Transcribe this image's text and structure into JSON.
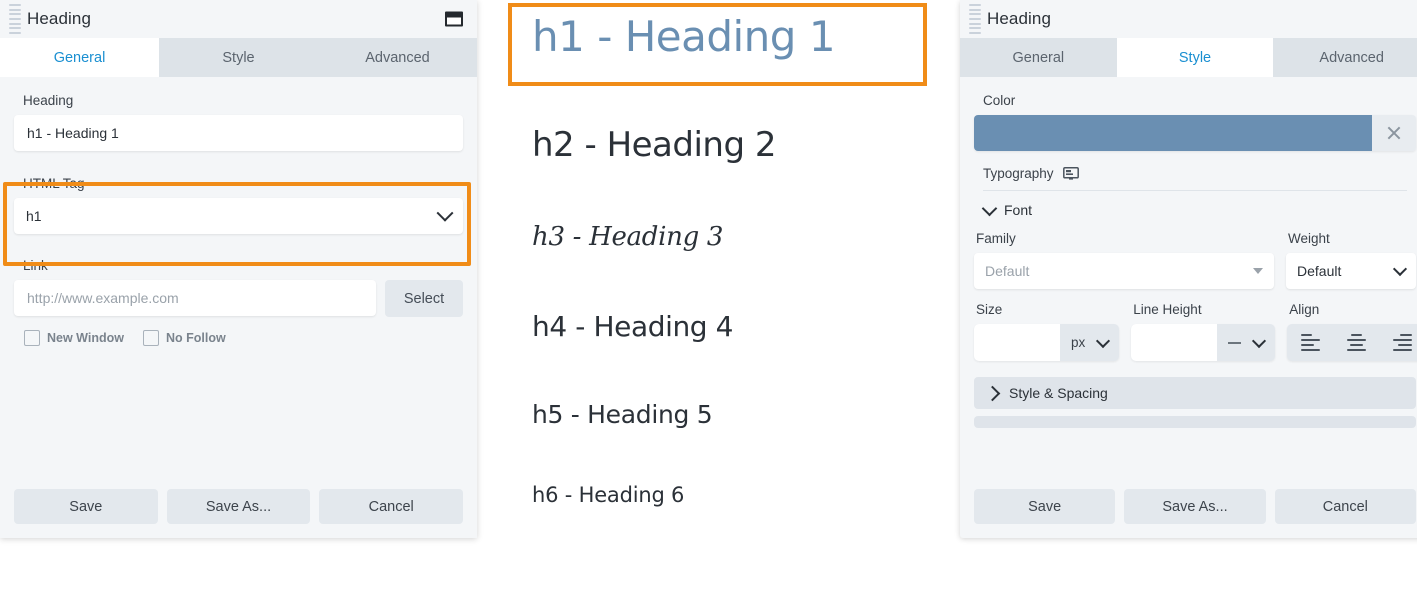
{
  "left_panel": {
    "title": "Heading",
    "window_button_icon": "restore-window-icon",
    "drag_handle_icon": "drag-handle-icon",
    "tabs": [
      {
        "label": "General",
        "active": true
      },
      {
        "label": "Style",
        "active": false
      },
      {
        "label": "Advanced",
        "active": false
      }
    ],
    "heading_field": {
      "label": "Heading",
      "value": "h1 - Heading 1"
    },
    "html_tag_field": {
      "label": "HTML Tag",
      "value": "h1",
      "highlighted": true,
      "highlight_color": "#f08c18",
      "chevron_icon": "chevron-down-icon"
    },
    "link_field": {
      "label": "Link",
      "placeholder": "http://www.example.com",
      "value": "",
      "select_button": "Select"
    },
    "checkboxes": [
      {
        "label": "New Window",
        "checked": false
      },
      {
        "label": "No Follow",
        "checked": false
      }
    ],
    "footer_buttons": [
      "Save",
      "Save As...",
      "Cancel"
    ]
  },
  "headings_preview": {
    "items": [
      {
        "label": "h1 - Heading 1",
        "tag": "h1",
        "color": "#6a8fb2",
        "highlighted": true
      },
      {
        "label": "h2 - Heading 2",
        "tag": "h2",
        "color": "#2b3138",
        "highlighted": false
      },
      {
        "label": "h3 - Heading 3",
        "tag": "h3",
        "color": "#2b3138",
        "highlighted": false
      },
      {
        "label": "h4 - Heading 4",
        "tag": "h4",
        "color": "#2b3138",
        "highlighted": false
      },
      {
        "label": "h5 - Heading 5",
        "tag": "h5",
        "color": "#2b3138",
        "highlighted": false
      },
      {
        "label": "h6 - Heading 6",
        "tag": "h6",
        "color": "#2b3138",
        "highlighted": false
      }
    ],
    "highlight_color": "#f08c18"
  },
  "right_panel": {
    "title": "Heading",
    "window_button_icon": "restore-window-icon",
    "drag_handle_icon": "drag-handle-icon",
    "tabs": [
      {
        "label": "General",
        "active": false
      },
      {
        "label": "Style",
        "active": true
      },
      {
        "label": "Advanced",
        "active": false
      }
    ],
    "color_field": {
      "label": "Color",
      "swatch_color": "#6a8fb2",
      "clear_icon": "close-icon"
    },
    "typography": {
      "label": "Typography",
      "device_icon": "monitor-icon",
      "font_section": {
        "label": "Font",
        "expanded": true,
        "chevron_icon": "chevron-down-icon",
        "family": {
          "label": "Family",
          "value": "Default",
          "dropdown_icon": "triangle-down-icon"
        },
        "weight": {
          "label": "Weight",
          "value": "Default",
          "dropdown_icon": "chevron-down-icon"
        },
        "size": {
          "label": "Size",
          "value": "",
          "unit": "px",
          "dropdown_icon": "chevron-down-icon"
        },
        "line_height": {
          "label": "Line Height",
          "value": "",
          "unit": "—",
          "dropdown_icon": "chevron-down-icon"
        },
        "align": {
          "label": "Align",
          "options": [
            "align-left-icon",
            "align-center-icon",
            "align-right-icon"
          ],
          "selected": null
        }
      },
      "style_spacing": {
        "label": "Style & Spacing",
        "expanded": false,
        "chevron_icon": "chevron-right-icon"
      }
    },
    "footer_buttons": [
      "Save",
      "Save As...",
      "Cancel"
    ]
  }
}
